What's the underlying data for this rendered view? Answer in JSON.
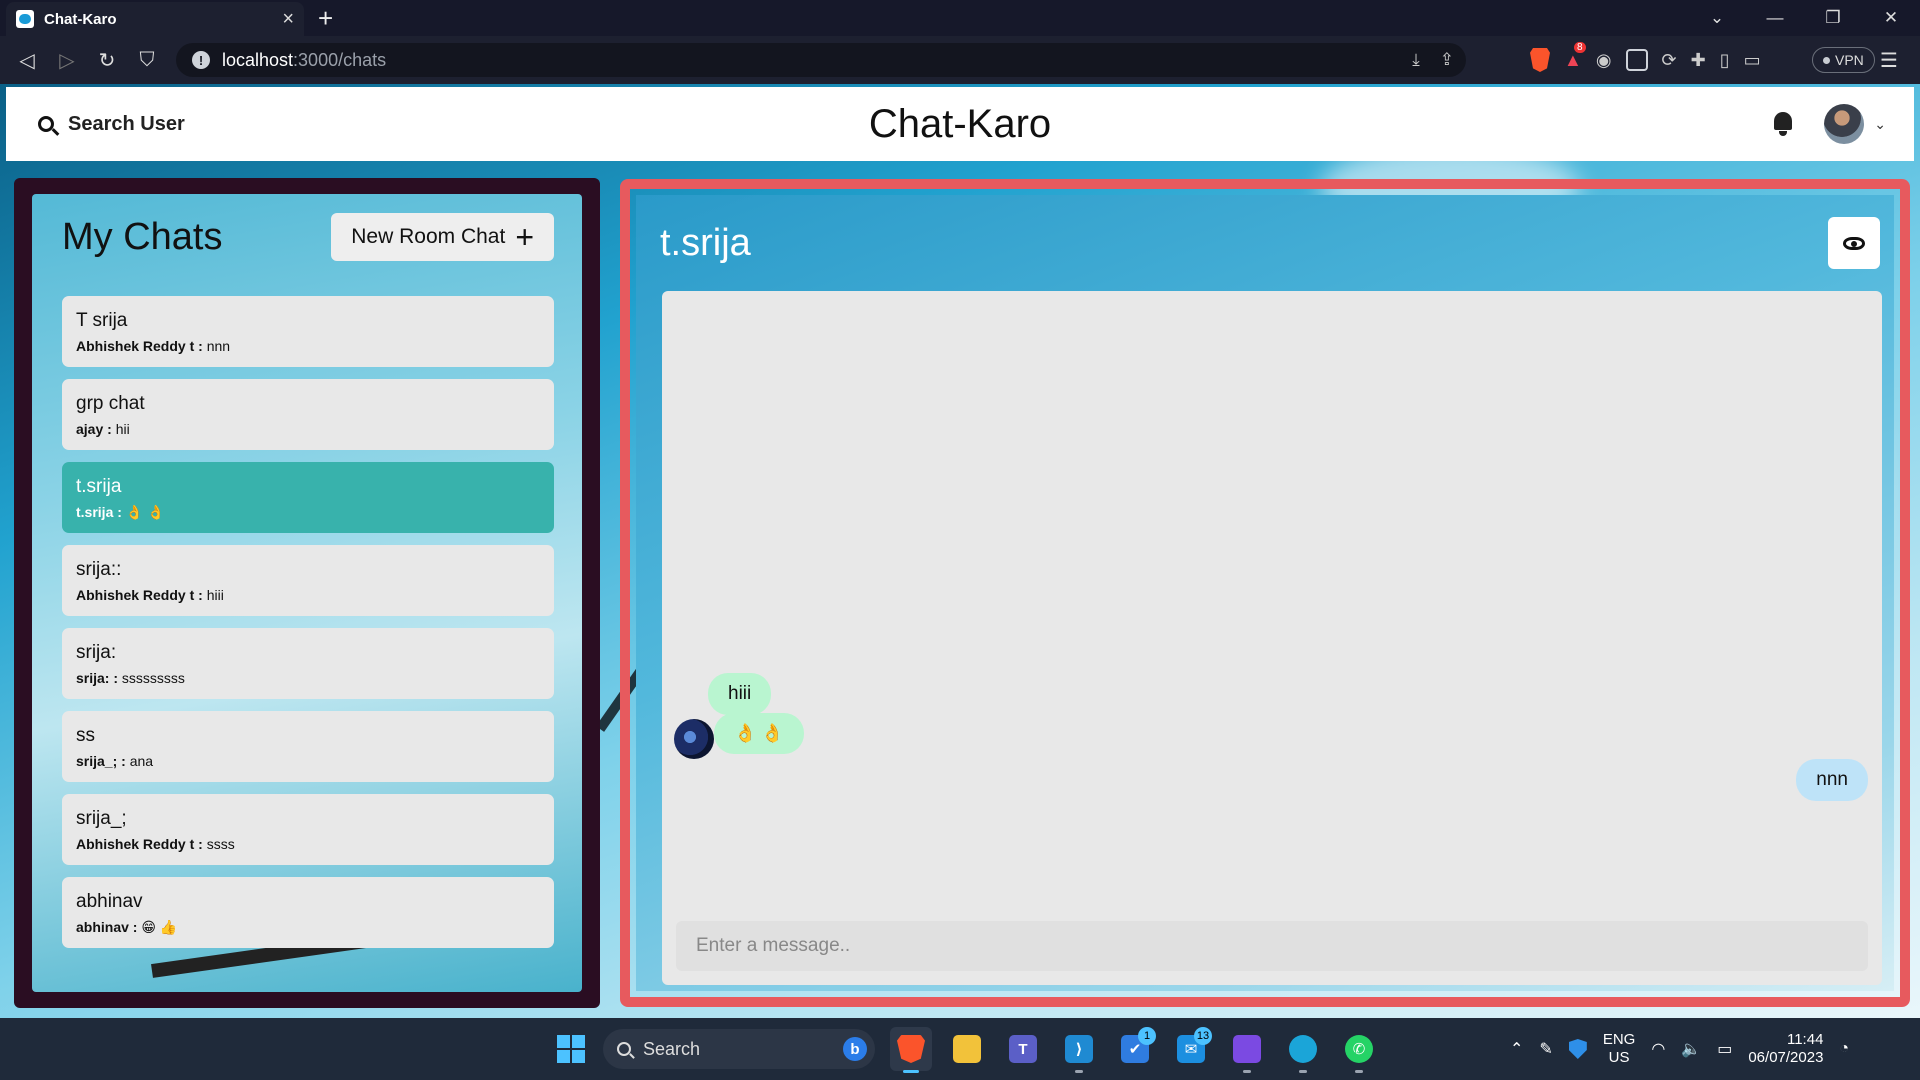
{
  "browser": {
    "tab_title": "Chat-Karo",
    "url_host": "localhost",
    "url_path": ":3000/chats",
    "vpn_label": "VPN",
    "brave_badge": "8"
  },
  "header": {
    "search_label": "Search User",
    "brand": "Chat-Karo"
  },
  "my_chats": {
    "title": "My Chats",
    "new_room_label": "New Room Chat",
    "chats": [
      {
        "name": "T srija",
        "sender": "Abhishek Reddy t :",
        "message": "nnn",
        "active": false
      },
      {
        "name": "grp chat",
        "sender": "ajay :",
        "message": "hii",
        "active": false
      },
      {
        "name": "t.srija",
        "sender": "t.srija :",
        "message": "👌 👌",
        "active": true
      },
      {
        "name": "srija::",
        "sender": "Abhishek Reddy t :",
        "message": "hiii",
        "active": false
      },
      {
        "name": "srija:",
        "sender": "srija: :",
        "message": "sssssssss",
        "active": false
      },
      {
        "name": "ss",
        "sender": "srija_; :",
        "message": "ana",
        "active": false
      },
      {
        "name": "srija_;",
        "sender": "Abhishek Reddy t :",
        "message": "ssss",
        "active": false
      },
      {
        "name": "abhinav",
        "sender": "abhinav :",
        "message": "😁 👍",
        "active": false
      }
    ]
  },
  "chat_box": {
    "title": "t.srija",
    "messages": [
      {
        "text": "hiii",
        "from": "other"
      },
      {
        "text": "👌 👌",
        "from": "other"
      },
      {
        "text": "nnn",
        "from": "me"
      }
    ],
    "input_placeholder": "Enter a message.."
  },
  "taskbar": {
    "search_label": "Search",
    "bing_label": "b",
    "todo_badge": "1",
    "mail_badge": "13",
    "lang_line1": "ENG",
    "lang_line2": "US",
    "time": "11:44",
    "date": "06/07/2023"
  },
  "colors": {
    "active_chat": "#38b2ac",
    "chat_box_border": "#e75a5e",
    "other_bubble": "#b9f5d0",
    "my_bubble": "#bee3f8",
    "left_panel_frame": "#2a0d22"
  }
}
